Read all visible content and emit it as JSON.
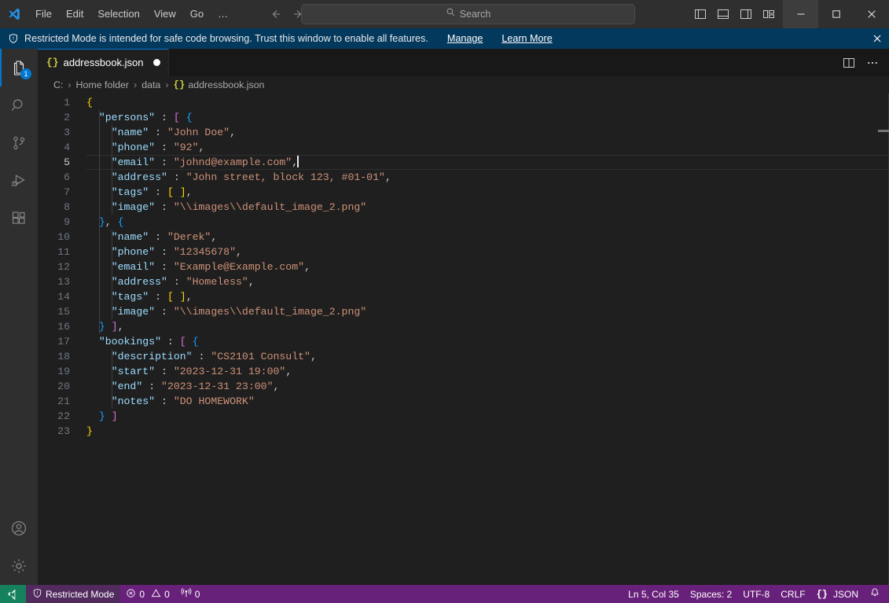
{
  "titlebar": {
    "logo_icon": "vscode-logo-icon",
    "menus": [
      "File",
      "Edit",
      "Selection",
      "View",
      "Go",
      "…"
    ],
    "nav_back_icon": "arrow-left-icon",
    "nav_forward_icon": "arrow-right-icon",
    "search": {
      "placeholder": "Search",
      "value": "",
      "icon": "search-icon"
    },
    "layout_icons": [
      "toggle-primary-sidebar-icon",
      "toggle-panel-icon",
      "toggle-secondary-sidebar-icon",
      "customize-layout-icon"
    ],
    "window_controls": {
      "minimize": "─",
      "maximize": "☐",
      "close": "✕"
    }
  },
  "banner": {
    "icon": "shield-icon",
    "message": "Restricted Mode is intended for safe code browsing. Trust this window to enable all features.",
    "manage_link": "Manage",
    "learn_more_link": "Learn More",
    "close_icon": "close-icon"
  },
  "activitybar": {
    "items": [
      {
        "name": "explorer",
        "icon": "files-icon",
        "badge": "1",
        "active": true
      },
      {
        "name": "search",
        "icon": "search-icon",
        "badge": "",
        "active": false
      },
      {
        "name": "source-control",
        "icon": "source-control-icon",
        "badge": "",
        "active": false
      },
      {
        "name": "run-and-debug",
        "icon": "run-and-debug-icon",
        "badge": "",
        "active": false
      },
      {
        "name": "extensions",
        "icon": "extensions-icon",
        "badge": "",
        "active": false
      }
    ],
    "bottom_items": [
      {
        "name": "accounts",
        "icon": "account-icon"
      },
      {
        "name": "manage",
        "icon": "gear-icon"
      }
    ]
  },
  "editor": {
    "tab": {
      "label": "addressbook.json",
      "icon": "json-braces-icon",
      "dirty": true
    },
    "tab_actions": [
      "split-editor-icon",
      "more-actions-icon"
    ],
    "breadcrumbs": [
      "C:",
      "Home folder",
      "data",
      "addressbook.json"
    ],
    "breadcrumb_file_icon": "json-braces-icon",
    "lines": [
      {
        "n": 1,
        "text": "{"
      },
      {
        "n": 2,
        "text": "  \"persons\" : [ {"
      },
      {
        "n": 3,
        "text": "    \"name\" : \"John Doe\","
      },
      {
        "n": 4,
        "text": "    \"phone\" : \"92\","
      },
      {
        "n": 5,
        "text": "    \"email\" : \"johnd@example.com\","
      },
      {
        "n": 6,
        "text": "    \"address\" : \"John street, block 123, #01-01\","
      },
      {
        "n": 7,
        "text": "    \"tags\" : [ ],"
      },
      {
        "n": 8,
        "text": "    \"image\" : \"\\\\images\\\\default_image_2.png\""
      },
      {
        "n": 9,
        "text": "  }, {"
      },
      {
        "n": 10,
        "text": "    \"name\" : \"Derek\","
      },
      {
        "n": 11,
        "text": "    \"phone\" : \"12345678\","
      },
      {
        "n": 12,
        "text": "    \"email\" : \"Example@Example.com\","
      },
      {
        "n": 13,
        "text": "    \"address\" : \"Homeless\","
      },
      {
        "n": 14,
        "text": "    \"tags\" : [ ],"
      },
      {
        "n": 15,
        "text": "    \"image\" : \"\\\\images\\\\default_image_2.png\""
      },
      {
        "n": 16,
        "text": "  } ],"
      },
      {
        "n": 17,
        "text": "  \"bookings\" : [ {"
      },
      {
        "n": 18,
        "text": "    \"description\" : \"CS2101 Consult\","
      },
      {
        "n": 19,
        "text": "    \"start\" : \"2023-12-31 19:00\","
      },
      {
        "n": 20,
        "text": "    \"end\" : \"2023-12-31 23:00\","
      },
      {
        "n": 21,
        "text": "    \"notes\" : \"DO HOMEWORK\""
      },
      {
        "n": 22,
        "text": "  } ]"
      },
      {
        "n": 23,
        "text": "}"
      }
    ],
    "active_line": 5
  },
  "statusbar": {
    "remote_icon": "remote-window-icon",
    "restricted_label": "Restricted Mode",
    "restricted_icon": "shield-icon",
    "errors": "0",
    "warnings": "0",
    "ports": "0",
    "error_icon": "error-circle-icon",
    "warning_icon": "warning-triangle-icon",
    "ports_icon": "radio-tower-icon",
    "cursor_position": "Ln 5, Col 35",
    "indentation": "Spaces: 2",
    "encoding": "UTF-8",
    "eol": "CRLF",
    "language": "JSON",
    "language_icon": "json-braces-icon",
    "notifications_icon": "bell-icon"
  },
  "colors": {
    "accent": "#0078d4",
    "statusbar_bg": "#68217a",
    "banner_bg": "#04395e",
    "remote_bg": "#16825d",
    "editor_bg": "#1f1f1f",
    "key": "#9cdcfe",
    "string": "#ce9178",
    "bracket0": "#ffd700",
    "bracket1": "#da70d6",
    "bracket2": "#179fff"
  }
}
